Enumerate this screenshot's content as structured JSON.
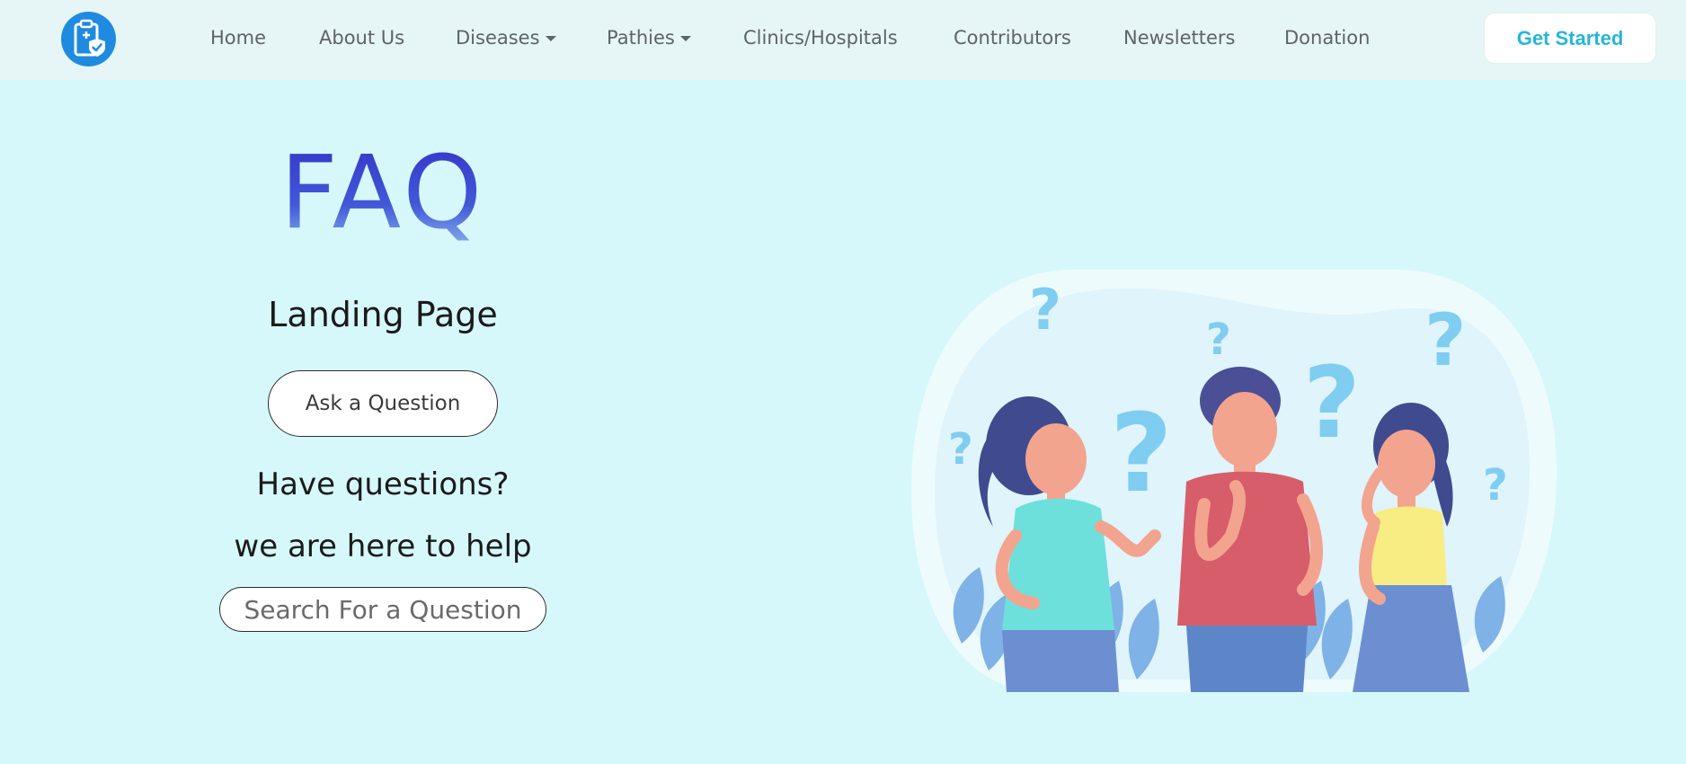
{
  "nav": {
    "items": [
      {
        "label": "Home"
      },
      {
        "label": "About Us"
      },
      {
        "label": "Diseases"
      },
      {
        "label": "Pathies"
      },
      {
        "label": "Clinics/Hospitals"
      },
      {
        "label": "Contributors"
      },
      {
        "label": "Newsletters"
      },
      {
        "label": "Donation"
      }
    ],
    "cta_label": "Get Started"
  },
  "hero": {
    "title": "FAQ",
    "subtitle": "Landing Page",
    "ask_button_label": "Ask a Question",
    "tagline_1": "Have questions?",
    "tagline_2": "we are here to help",
    "search_placeholder": "Search For a Question"
  },
  "colors": {
    "page_background": "#d6f8fb",
    "navbar_background": "#e6f6f6",
    "logo_blue": "#1f8be0",
    "cta_text": "#26b6d8",
    "title_gradient_start": "#3433c8",
    "title_gradient_end": "#8dbbec"
  },
  "icons": {
    "logo": "clipboard-shield-icon",
    "dropdown": "caret-down-icon"
  }
}
